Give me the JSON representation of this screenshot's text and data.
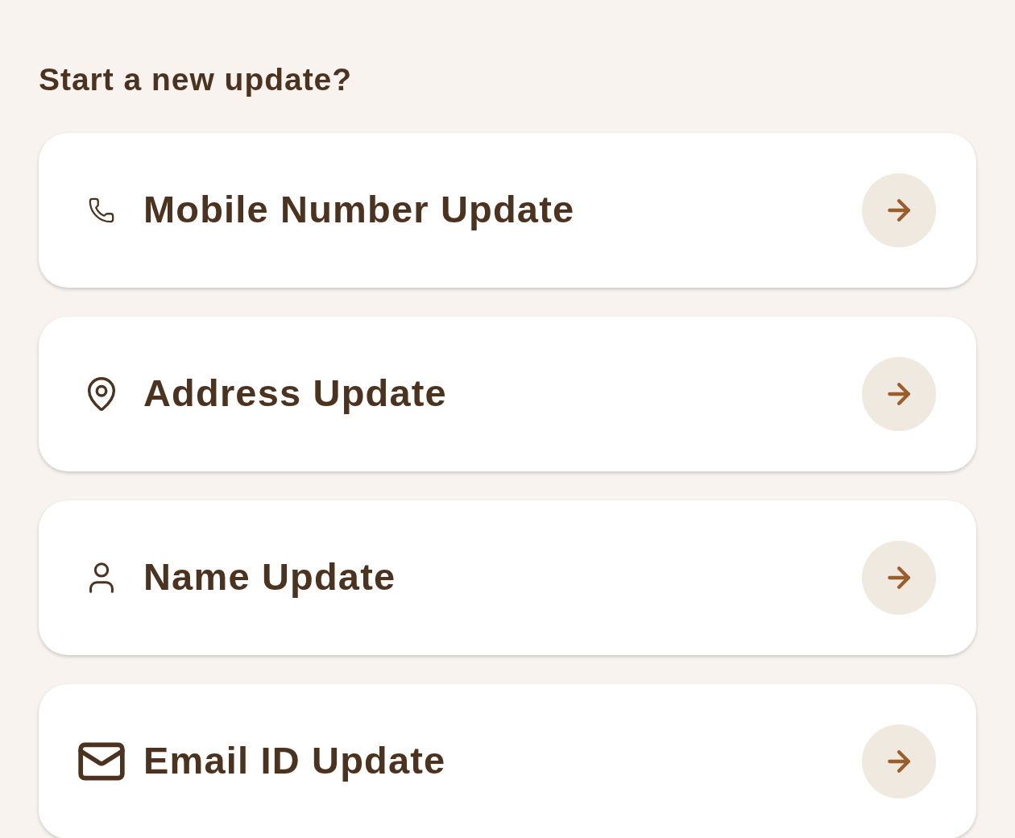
{
  "heading": "Start a new update?",
  "options": [
    {
      "kind": "phone",
      "label": "Mobile Number Update"
    },
    {
      "kind": "pin",
      "label": "Address Update"
    },
    {
      "kind": "person",
      "label": "Name Update"
    },
    {
      "kind": "mail",
      "label": "Email ID Update"
    }
  ]
}
